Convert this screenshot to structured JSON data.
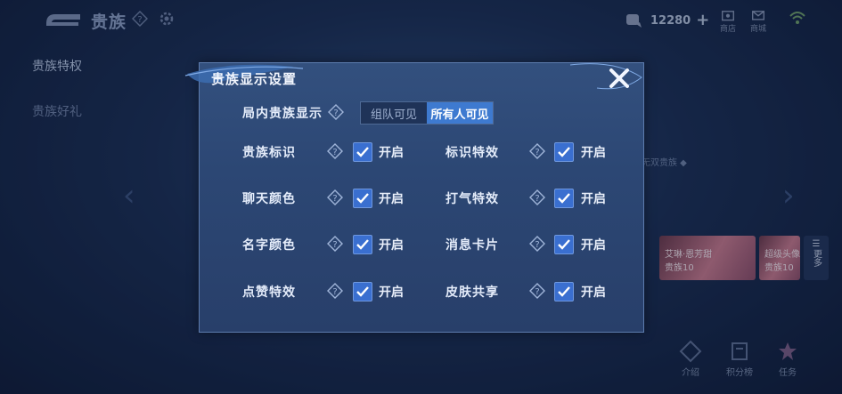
{
  "header": {
    "title": "贵族",
    "currency_amount": "12280",
    "icons": [
      {
        "name": "gift-icon",
        "label": "商店"
      },
      {
        "name": "mail-icon",
        "label": "商城"
      },
      {
        "name": "wifi-icon",
        "label": ""
      }
    ]
  },
  "sidebar": {
    "items": [
      {
        "label": "贵族特权"
      },
      {
        "label": "贵族好礼"
      }
    ]
  },
  "background": {
    "banner_text": "无双贵族 ◆",
    "cards": [
      {
        "title": "艾琳·恩芳甜",
        "sub": "贵族10"
      },
      {
        "title": "超级头像",
        "sub": "贵族10"
      }
    ],
    "more_label": "更多",
    "bottom_buttons": [
      {
        "label": "介绍"
      },
      {
        "label": "积分榜"
      },
      {
        "label": "任务"
      }
    ]
  },
  "dialog": {
    "title": "贵族显示设置",
    "display_row": {
      "label": "局内贵族显示",
      "options": [
        "组队可见",
        "所有人可见"
      ],
      "selected": "所有人可见"
    },
    "settings": [
      {
        "label": "贵族标识",
        "checked": true,
        "state": "开启"
      },
      {
        "label": "标识特效",
        "checked": true,
        "state": "开启"
      },
      {
        "label": "聊天颜色",
        "checked": true,
        "state": "开启"
      },
      {
        "label": "打气特效",
        "checked": true,
        "state": "开启"
      },
      {
        "label": "名字颜色",
        "checked": true,
        "state": "开启"
      },
      {
        "label": "消息卡片",
        "checked": true,
        "state": "开启"
      },
      {
        "label": "点赞特效",
        "checked": true,
        "state": "开启"
      },
      {
        "label": "皮肤共享",
        "checked": true,
        "state": "开启"
      }
    ]
  },
  "colors": {
    "accent": "#3a6fd0",
    "dialog_bg": "#2c4774",
    "page_bg": "#1a2f55"
  }
}
